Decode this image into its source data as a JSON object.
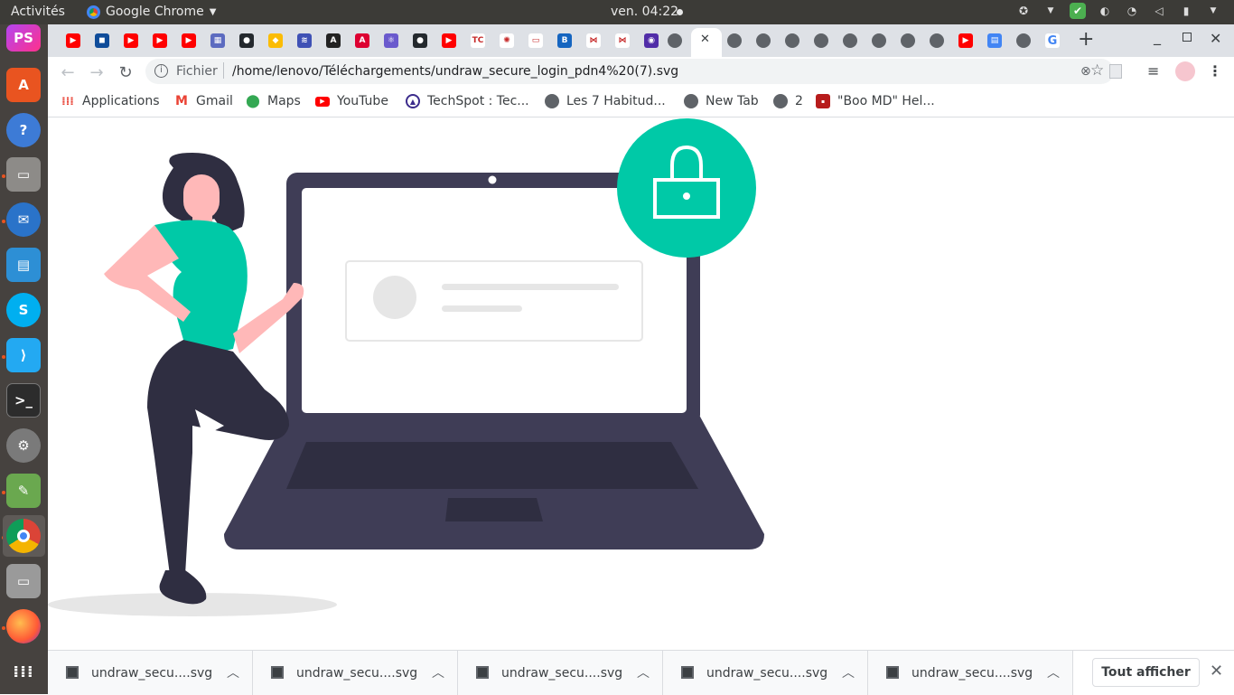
{
  "topbar": {
    "activities": "Activités",
    "app_name": "Google Chrome",
    "clock": "ven. 04:22"
  },
  "tabs": {
    "active_close": "✕",
    "new_tab": "+"
  },
  "toolbar": {
    "scheme": "Fichier",
    "url": "/home/lenovo/Téléchargements/undraw_secure_login_pdn4%20(7).svg"
  },
  "bookmarks": [
    {
      "label": "Applications",
      "icon": "apps-grid-icon"
    },
    {
      "label": "Gmail",
      "icon": "gmail-icon"
    },
    {
      "label": "Maps",
      "icon": "maps-icon"
    },
    {
      "label": "YouTube",
      "icon": "youtube-icon"
    },
    {
      "label": "TechSpot : Tec...",
      "icon": "techspot-icon"
    },
    {
      "label": "Les 7 Habitud...",
      "icon": "globe-icon"
    },
    {
      "label": "New Tab",
      "icon": "globe-icon"
    },
    {
      "label": "2",
      "icon": "globe-icon"
    },
    {
      "label": "\"Boo MD\" Hel...",
      "icon": "boo-icon"
    }
  ],
  "downloads": [
    {
      "name": "undraw_secu....svg"
    },
    {
      "name": "undraw_secu....svg"
    },
    {
      "name": "undraw_secu....svg"
    },
    {
      "name": "undraw_secu....svg"
    },
    {
      "name": "undraw_secu....svg"
    }
  ],
  "shelf": {
    "show_all": "Tout afficher"
  },
  "colors": {
    "accent_green": "#00c9a7",
    "laptop_dark": "#3f3d56",
    "person_skin": "#ffb8b8",
    "person_hair": "#2f2e41"
  }
}
